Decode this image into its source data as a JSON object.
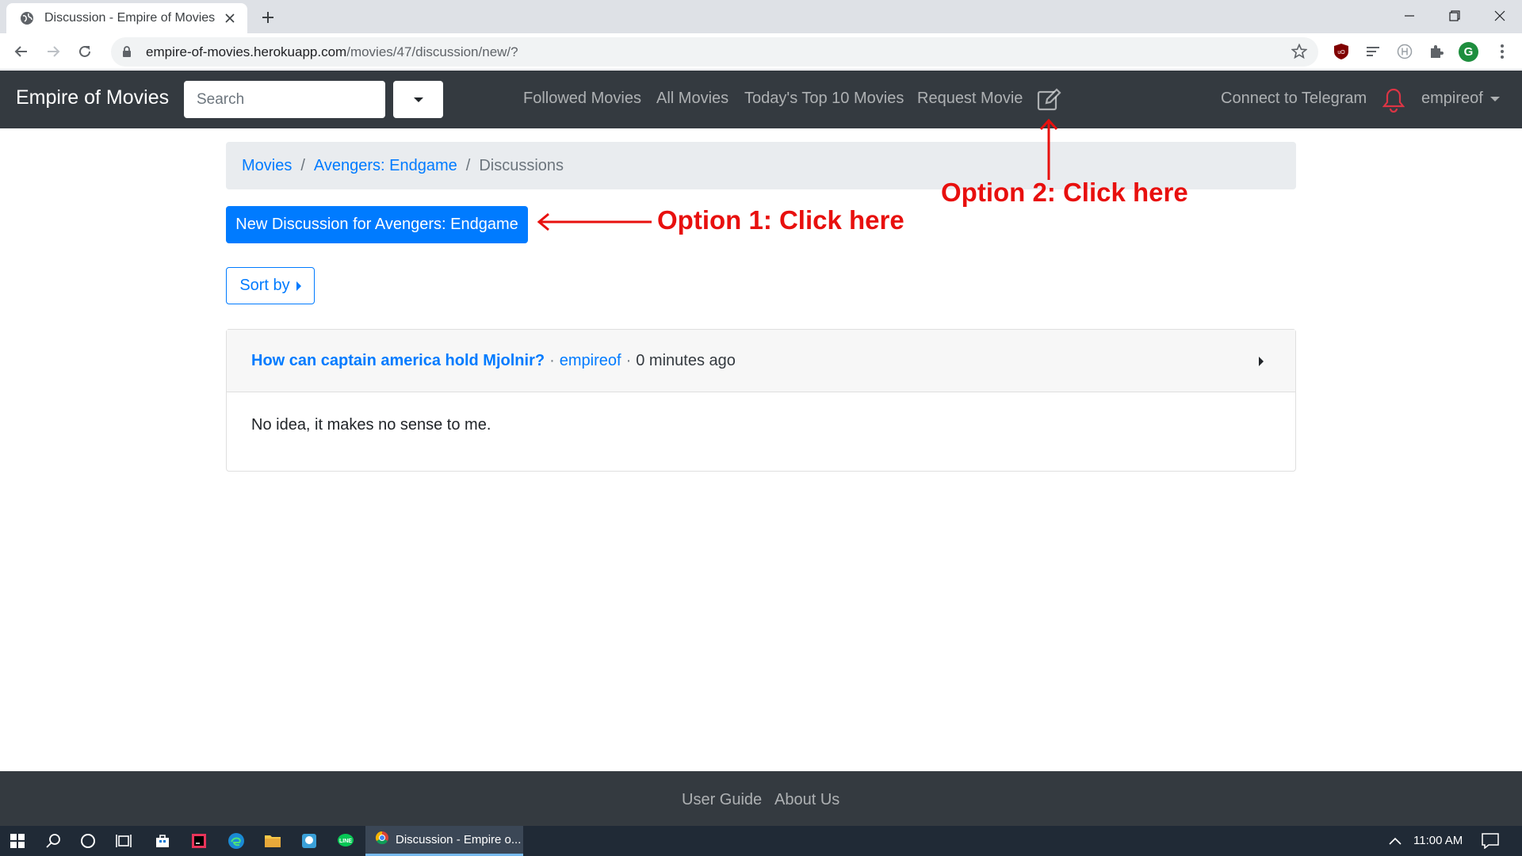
{
  "browser": {
    "tab_title": "Discussion - Empire of Movies",
    "url_host": "empire-of-movies.herokuapp.com",
    "url_path": "/movies/47/discussion/new/?",
    "profile_initial": "G"
  },
  "navbar": {
    "brand": "Empire of Movies",
    "search_placeholder": "Search",
    "links": [
      "Followed Movies",
      "All Movies",
      "Today's Top 10 Movies",
      "Request Movie"
    ],
    "telegram": "Connect to Telegram",
    "user": "empireof"
  },
  "breadcrumb": {
    "items": [
      "Movies",
      "Avengers: Endgame"
    ],
    "active": "Discussions"
  },
  "actions": {
    "new_discussion": "New Discussion for Avengers: Endgame",
    "sort_by": "Sort by"
  },
  "discussion": {
    "title": "How can captain america hold Mjolnir?",
    "separator": "·",
    "author": "empireof",
    "time": "0 minutes ago",
    "body": "No idea, it makes no sense to me."
  },
  "annotations": {
    "option1": "Option 1: Click here",
    "option2": "Option 2: Click here",
    "color": "#e8100e"
  },
  "footer": {
    "links": [
      "User Guide",
      "About Us"
    ]
  },
  "taskbar": {
    "active_task": "Discussion - Empire o...",
    "clock": "11:00 AM"
  },
  "colors": {
    "navbar": "#343a40",
    "primary": "#007bff",
    "bell": "#dc3545"
  }
}
